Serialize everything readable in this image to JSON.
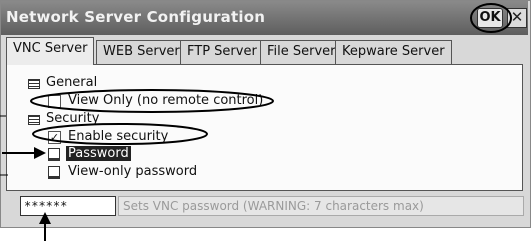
{
  "window": {
    "title": "Network Server Configuration",
    "ok_label": "OK",
    "close_label": "✕"
  },
  "tabs": [
    {
      "label": "VNC Server",
      "active": true
    },
    {
      "label": "WEB Server",
      "active": false
    },
    {
      "label": "FTP Server",
      "active": false
    },
    {
      "label": "File Server",
      "active": false
    },
    {
      "label": "Kepware Server",
      "active": false
    }
  ],
  "tree": {
    "general": {
      "label": "General",
      "icon": "section-icon"
    },
    "view_only": {
      "label": "View Only (no remote control)",
      "checked": false
    },
    "security": {
      "label": "Security",
      "icon": "section-icon"
    },
    "enable_security": {
      "label": "Enable security",
      "checked": true,
      "mark": "✓"
    },
    "password": {
      "label": "Password",
      "selected": true,
      "icon": "document-icon"
    },
    "view_only_password": {
      "label": "View-only password",
      "icon": "document-icon"
    }
  },
  "password_field": {
    "value": "******"
  },
  "description": {
    "text": "Sets VNC password (WARNING: 7 characters max)"
  },
  "colors": {
    "titlebar": "#6e6e6e",
    "panel": "#fbfbfb",
    "selection": "#222222"
  }
}
